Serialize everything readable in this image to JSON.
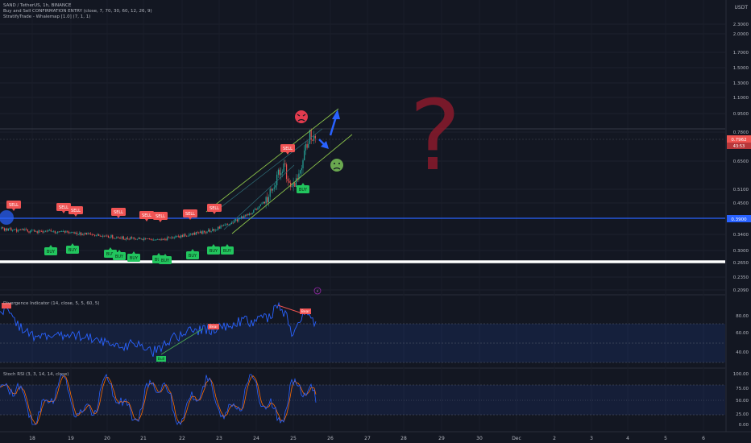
{
  "header": {
    "symbol_line": "SAND / TetherUS, 1h, BINANCE",
    "indicator1": "Buy and Sell CONFIRMATION ENTRY (close, 7, 70, 30, 60, 12, 26, 9)",
    "indicator2": "StratifyTrade - Whalemap [1.0] (7, 1, 1)",
    "currency": "USDT"
  },
  "price_axis": {
    "labels": [
      "2.3000",
      "2.0000",
      "1.7000",
      "1.5000",
      "1.3000",
      "1.1000",
      "0.9500",
      "0.7800",
      "0.6500",
      "0.5100",
      "0.4500",
      "0.3900",
      "0.3400",
      "0.3000",
      "0.2650",
      "0.2350",
      "0.2090"
    ],
    "current_price": "0.7962",
    "countdown": "43:53",
    "line_price": "0.3900"
  },
  "time_axis": {
    "labels": [
      "18",
      "19",
      "20",
      "21",
      "22",
      "23",
      "24",
      "25",
      "26",
      "27",
      "28",
      "29",
      "30",
      "Dec",
      "2",
      "3",
      "4",
      "5",
      "6"
    ]
  },
  "signals": {
    "sell_label": "SELL",
    "buy_label": "BUY",
    "question_mark": "?",
    "alert_glyph": "⚡"
  },
  "divergence_pane": {
    "title": "Divergence Indicator (14, close, 5, 5, 60, 5)",
    "bear_label": "Bear",
    "bull_label": "Bull",
    "axis_labels": [
      "80.00",
      "60.00",
      "40.00"
    ]
  },
  "stoch_pane": {
    "title": "Stoch RSI (3, 3, 14, 14, close)",
    "axis_labels": [
      "100.00",
      "75.00",
      "50.00",
      "25.00",
      "0.00"
    ]
  },
  "colors": {
    "background": "#131722",
    "up": "#26a69a",
    "down": "#ef5350",
    "sell": "#f05454",
    "buy": "#22c55e",
    "level": "#2962ff",
    "channel": "#8bc34a",
    "rsi": "#2962ff",
    "stoch_k": "#2962ff",
    "stoch_d": "#ff6d00"
  }
}
